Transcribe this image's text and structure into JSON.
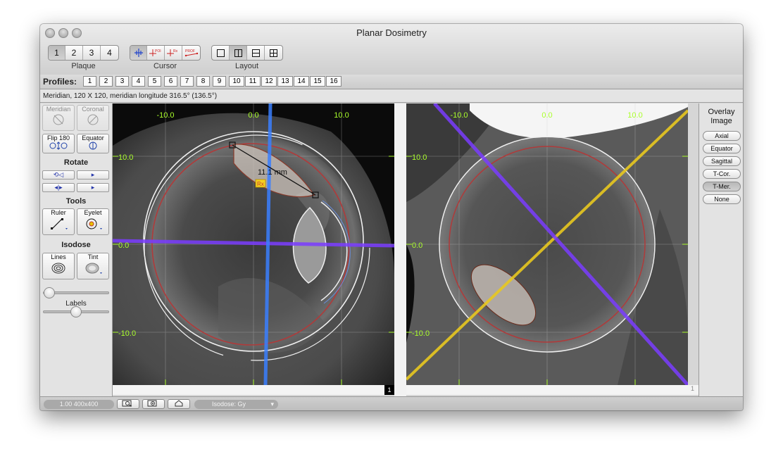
{
  "window": {
    "title": "Planar Dosimetry"
  },
  "toolbar": {
    "plaque": {
      "label": "Plaque",
      "buttons": [
        "1",
        "2",
        "3",
        "4"
      ],
      "selected": "1"
    },
    "cursor": {
      "label": "Cursor",
      "buttons": [
        "crosshair",
        "POI",
        "Rx",
        "PROF"
      ]
    },
    "layout": {
      "label": "Layout",
      "buttons": [
        "single-view",
        "two-views-vertical",
        "two-views-horizontal",
        "four-views"
      ],
      "selected": "two-views-vertical"
    }
  },
  "profiles": {
    "label": "Profiles:",
    "buttons": [
      "1",
      "2",
      "3",
      "4",
      "5",
      "6",
      "7",
      "8",
      "9",
      "10",
      "11",
      "12",
      "13",
      "14",
      "15",
      "16"
    ]
  },
  "info": {
    "text": "Meridian, 120 X 120, meridian longitude 316.5° (136.5°)"
  },
  "left_panel": {
    "meridian": "Meridian",
    "coronal": "Coronal",
    "flip180": "Flip 180",
    "equator": "Equator",
    "rotate_title": "Rotate",
    "tools_title": "Tools",
    "ruler": "Ruler",
    "eyelet": "Eyelet",
    "isodose_title": "Isodose",
    "lines": "Lines",
    "tint": "Tint",
    "labels": "Labels"
  },
  "viewer_left": {
    "x_ticks": [
      "-10.0",
      "0.0",
      "10.0"
    ],
    "y_ticks": [
      "10.0",
      "0.0",
      "-10.0"
    ],
    "measurement": "11.1 mm",
    "rx_marker": "Rx",
    "view_number": "1"
  },
  "viewer_right": {
    "x_ticks": [
      "-10.0",
      "0.0",
      "10.0"
    ],
    "y_ticks": [
      "10.0",
      "0.0",
      "-10.0"
    ],
    "view_number": "1"
  },
  "overlay": {
    "title_line1": "Overlay",
    "title_line2": "Image",
    "buttons": [
      "Axial",
      "Equator",
      "Sagittal",
      "T-Cor.",
      "T-Mer.",
      "None"
    ],
    "selected": "T-Mer."
  },
  "statusbar": {
    "zoom": "1.00 400x400",
    "isodose": "Isodose: Gy"
  },
  "colors": {
    "grid_label": "#aaff2a",
    "sclera_ring": "#b03a3a",
    "meridian_line": "#7a3cff",
    "cursor_line": "#3a7fff",
    "overlay_line": "#e8c81f"
  }
}
